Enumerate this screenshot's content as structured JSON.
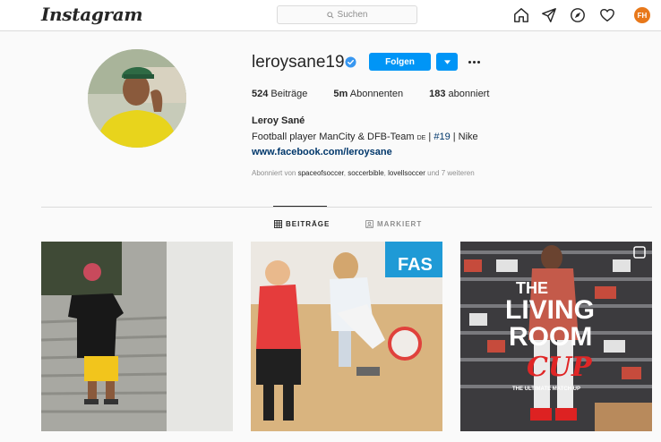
{
  "header": {
    "logo": "Instagram",
    "search_placeholder": "Suchen",
    "avatar_initials": "FH"
  },
  "profile": {
    "username": "leroysane19",
    "verified": true,
    "follow_label": "Folgen",
    "stats": {
      "posts_count": "524",
      "posts_label": "Beiträge",
      "followers_count": "5m",
      "followers_label": "Abonnenten",
      "following_count": "183",
      "following_label": "abonniert"
    },
    "full_name": "Leroy Sané",
    "bio_prefix": "Football player ManCity & DFB-Team",
    "bio_flag": "DE",
    "bio_sep1": " | ",
    "bio_hashtag": "#19",
    "bio_suffix": " | Nike",
    "website": "www.facebook.com/leroysane",
    "followed_by": {
      "prefix": "Abonniert von",
      "user1": "spaceofsoccer",
      "user2": "soccerbible",
      "user3": "lovellsoccer",
      "suffix": "und 7 weiteren"
    }
  },
  "tabs": {
    "posts": "BEITRÄGE",
    "tagged": "MARKIERT"
  },
  "posts": {
    "post1_alt": "Boy standing on stairs",
    "post2_alt": "Youth football players",
    "post2_banner": "FAS",
    "post3_title1": "THE",
    "post3_title2": "LIVING",
    "post3_title3": "ROOM",
    "post3_title4": "CUP",
    "post3_subtitle": "THE ULTIMATE MATCH UP"
  },
  "colors": {
    "accent": "#0095f6",
    "link": "#00376b",
    "muted": "#8e8e8e",
    "border": "#dbdbdb"
  }
}
